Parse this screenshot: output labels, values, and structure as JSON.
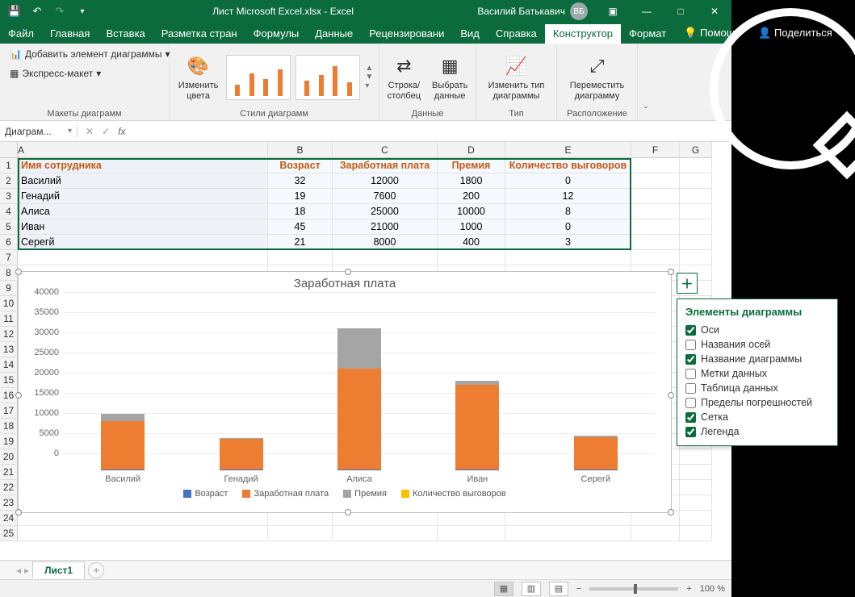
{
  "title": "Лист Microsoft Excel.xlsx  -  Excel",
  "user": {
    "name": "Василий Батькавич",
    "initials": "ВБ"
  },
  "qat": {
    "save": "💾",
    "undo": "↶",
    "redo": "↷"
  },
  "tabs": [
    "Файл",
    "Главная",
    "Вставка",
    "Разметка стран",
    "Формулы",
    "Данные",
    "Рецензировани",
    "Вид",
    "Справка",
    "Конструктор",
    "Формат"
  ],
  "tabs_active": "Конструктор",
  "tabs_right": {
    "help": "Помощь",
    "share": "Поделиться"
  },
  "ribbon": {
    "layouts_group": "Макеты диаграмм",
    "add_element": "Добавить элемент диаграммы",
    "quick_layout": "Экспресс-макет",
    "change_colors": "Изменить\nцвета",
    "styles_group": "Стили диаграмм",
    "data_group": "Данные",
    "swap": "Строка/\nстолбец",
    "select_data": "Выбрать\nданные",
    "type_group": "Тип",
    "change_type": "Изменить тип\nдиаграммы",
    "location_group": "Расположение",
    "move": "Переместить\nдиаграмму"
  },
  "namebox": "Диаграм...",
  "columns": [
    "A",
    "B",
    "C",
    "D",
    "E",
    "F",
    "G"
  ],
  "table": {
    "headers": [
      "Имя сотрудника",
      "Возраст",
      "Заработная плата",
      "Премия",
      "Количество выговоров"
    ],
    "rows": [
      {
        "name": "Василий",
        "age": 32,
        "salary": 12000,
        "bonus": 1800,
        "repr": 0
      },
      {
        "name": "Генадий",
        "age": 19,
        "salary": 7600,
        "bonus": 200,
        "repr": 12
      },
      {
        "name": "Алиса",
        "age": 18,
        "salary": 25000,
        "bonus": 10000,
        "repr": 8
      },
      {
        "name": "Иван",
        "age": 45,
        "salary": 21000,
        "bonus": 1000,
        "repr": 0
      },
      {
        "name": "Серегй",
        "age": 21,
        "salary": 8000,
        "bonus": 400,
        "repr": 3
      }
    ]
  },
  "chart_data": {
    "type": "bar",
    "stacked": true,
    "title": "Заработная плата",
    "categories": [
      "Василий",
      "Генадий",
      "Алиса",
      "Иван",
      "Серегй"
    ],
    "series": [
      {
        "name": "Возраст",
        "color": "#4472c4",
        "values": [
          32,
          19,
          18,
          45,
          21
        ]
      },
      {
        "name": "Заработная плата",
        "color": "#ed7d31",
        "values": [
          12000,
          7600,
          25000,
          21000,
          8000
        ]
      },
      {
        "name": "Премия",
        "color": "#a5a5a5",
        "values": [
          1800,
          200,
          10000,
          1000,
          400
        ]
      },
      {
        "name": "Количество выговоров",
        "color": "#ffc000",
        "values": [
          0,
          12,
          8,
          0,
          3
        ]
      }
    ],
    "ylim": [
      0,
      40000
    ],
    "yticks": [
      0,
      5000,
      10000,
      15000,
      20000,
      25000,
      30000,
      35000,
      40000
    ]
  },
  "chart_elements_panel": {
    "title": "Элементы диаграммы",
    "items": [
      {
        "label": "Оси",
        "checked": true
      },
      {
        "label": "Названия осей",
        "checked": false
      },
      {
        "label": "Название диаграммы",
        "checked": true
      },
      {
        "label": "Метки данных",
        "checked": false
      },
      {
        "label": "Таблица данных",
        "checked": false
      },
      {
        "label": "Пределы погрешностей",
        "checked": false
      },
      {
        "label": "Сетка",
        "checked": true
      },
      {
        "label": "Легенда",
        "checked": true
      }
    ]
  },
  "sheet_tab": "Лист1",
  "zoom": "100 %"
}
